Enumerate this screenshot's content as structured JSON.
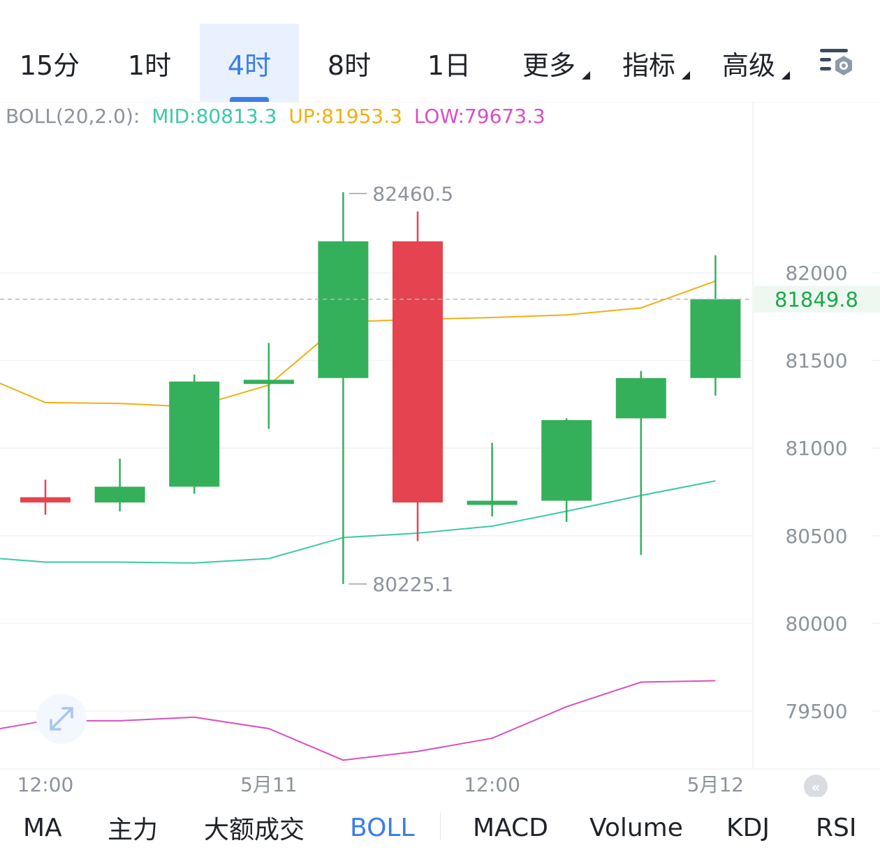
{
  "timeframes": [
    {
      "label": "15分",
      "active": false,
      "dropdown": false
    },
    {
      "label": "1时",
      "active": false,
      "dropdown": false
    },
    {
      "label": "4时",
      "active": true,
      "dropdown": false
    },
    {
      "label": "8时",
      "active": false,
      "dropdown": false
    },
    {
      "label": "1日",
      "active": false,
      "dropdown": false
    },
    {
      "label": "更多",
      "active": false,
      "dropdown": true
    },
    {
      "label": "指标",
      "active": false,
      "dropdown": true
    },
    {
      "label": "高级",
      "active": false,
      "dropdown": true
    }
  ],
  "settings_icon": "chart-settings-icon",
  "boll_legend": {
    "name": "BOLL(20,2.0):",
    "mid": "MID:80813.3",
    "up": "UP:81953.3",
    "low": "LOW:79673.3"
  },
  "indicators": [
    {
      "label": "MA",
      "active": false
    },
    {
      "label": "主力",
      "active": false
    },
    {
      "label": "大额成交",
      "active": false
    },
    {
      "label": "BOLL",
      "active": true
    },
    {
      "label": "MACD",
      "active": false
    },
    {
      "label": "Volume",
      "active": false
    },
    {
      "label": "KDJ",
      "active": false
    },
    {
      "label": "RSI",
      "active": false
    }
  ],
  "colors": {
    "up": "#34b05a",
    "down": "#e4434f",
    "mid": "#3cc8a8",
    "upper": "#efb014",
    "lower": "#d94fc0",
    "accent": "#3a7ee8",
    "last_price": "#1ea84b"
  },
  "chart_data": {
    "type": "candlestick",
    "y_ticks": [
      82000,
      81500,
      81000,
      80500,
      80000,
      79500
    ],
    "ylim": [
      79250,
      82550
    ],
    "x_ticks": [
      {
        "index": 0,
        "label": "12:00"
      },
      {
        "index": 3,
        "label": "5月11"
      },
      {
        "index": 6,
        "label": "12:00"
      },
      {
        "index": 9,
        "label": "5月12"
      }
    ],
    "grid": true,
    "last_price": 81849.8,
    "last_price_label": "81849.8",
    "high_marker": {
      "index": 4,
      "value": 82460.5,
      "label": "82460.5"
    },
    "low_marker": {
      "index": 4,
      "value": 80225.1,
      "label": "80225.1"
    },
    "candles": [
      {
        "open": 80720,
        "high": 80820,
        "low": 80620,
        "close": 80690
      },
      {
        "open": 80690,
        "high": 80940,
        "low": 80640,
        "close": 80780
      },
      {
        "open": 80780,
        "high": 81420,
        "low": 80740,
        "close": 81380
      },
      {
        "open": 81370,
        "high": 81600,
        "low": 81110,
        "close": 81390
      },
      {
        "open": 81400,
        "high": 82460.5,
        "low": 80225.1,
        "close": 82180
      },
      {
        "open": 82180,
        "high": 82350,
        "low": 80470,
        "close": 80690
      },
      {
        "open": 80690,
        "high": 81030,
        "low": 80610,
        "close": 80700
      },
      {
        "open": 80700,
        "high": 81170,
        "low": 80580,
        "close": 81160
      },
      {
        "open": 81170,
        "high": 81440,
        "low": 80390,
        "close": 81400
      },
      {
        "open": 81400,
        "high": 82100,
        "low": 81300,
        "close": 81849.8
      }
    ],
    "series": [
      {
        "name": "MID",
        "values": [
          80350,
          80350,
          80345,
          80370,
          80490,
          80515,
          80555,
          80640,
          80730,
          80813.3
        ],
        "lead_in": 80370
      },
      {
        "name": "UP",
        "values": [
          81260,
          81255,
          81235,
          81360,
          81720,
          81735,
          81745,
          81760,
          81800,
          81953.3
        ],
        "lead_in": 81370
      },
      {
        "name": "LOW",
        "values": [
          79445,
          79445,
          79465,
          79400,
          79220,
          79270,
          79345,
          79525,
          79665,
          79673.3
        ],
        "lead_in": 79400
      }
    ]
  }
}
